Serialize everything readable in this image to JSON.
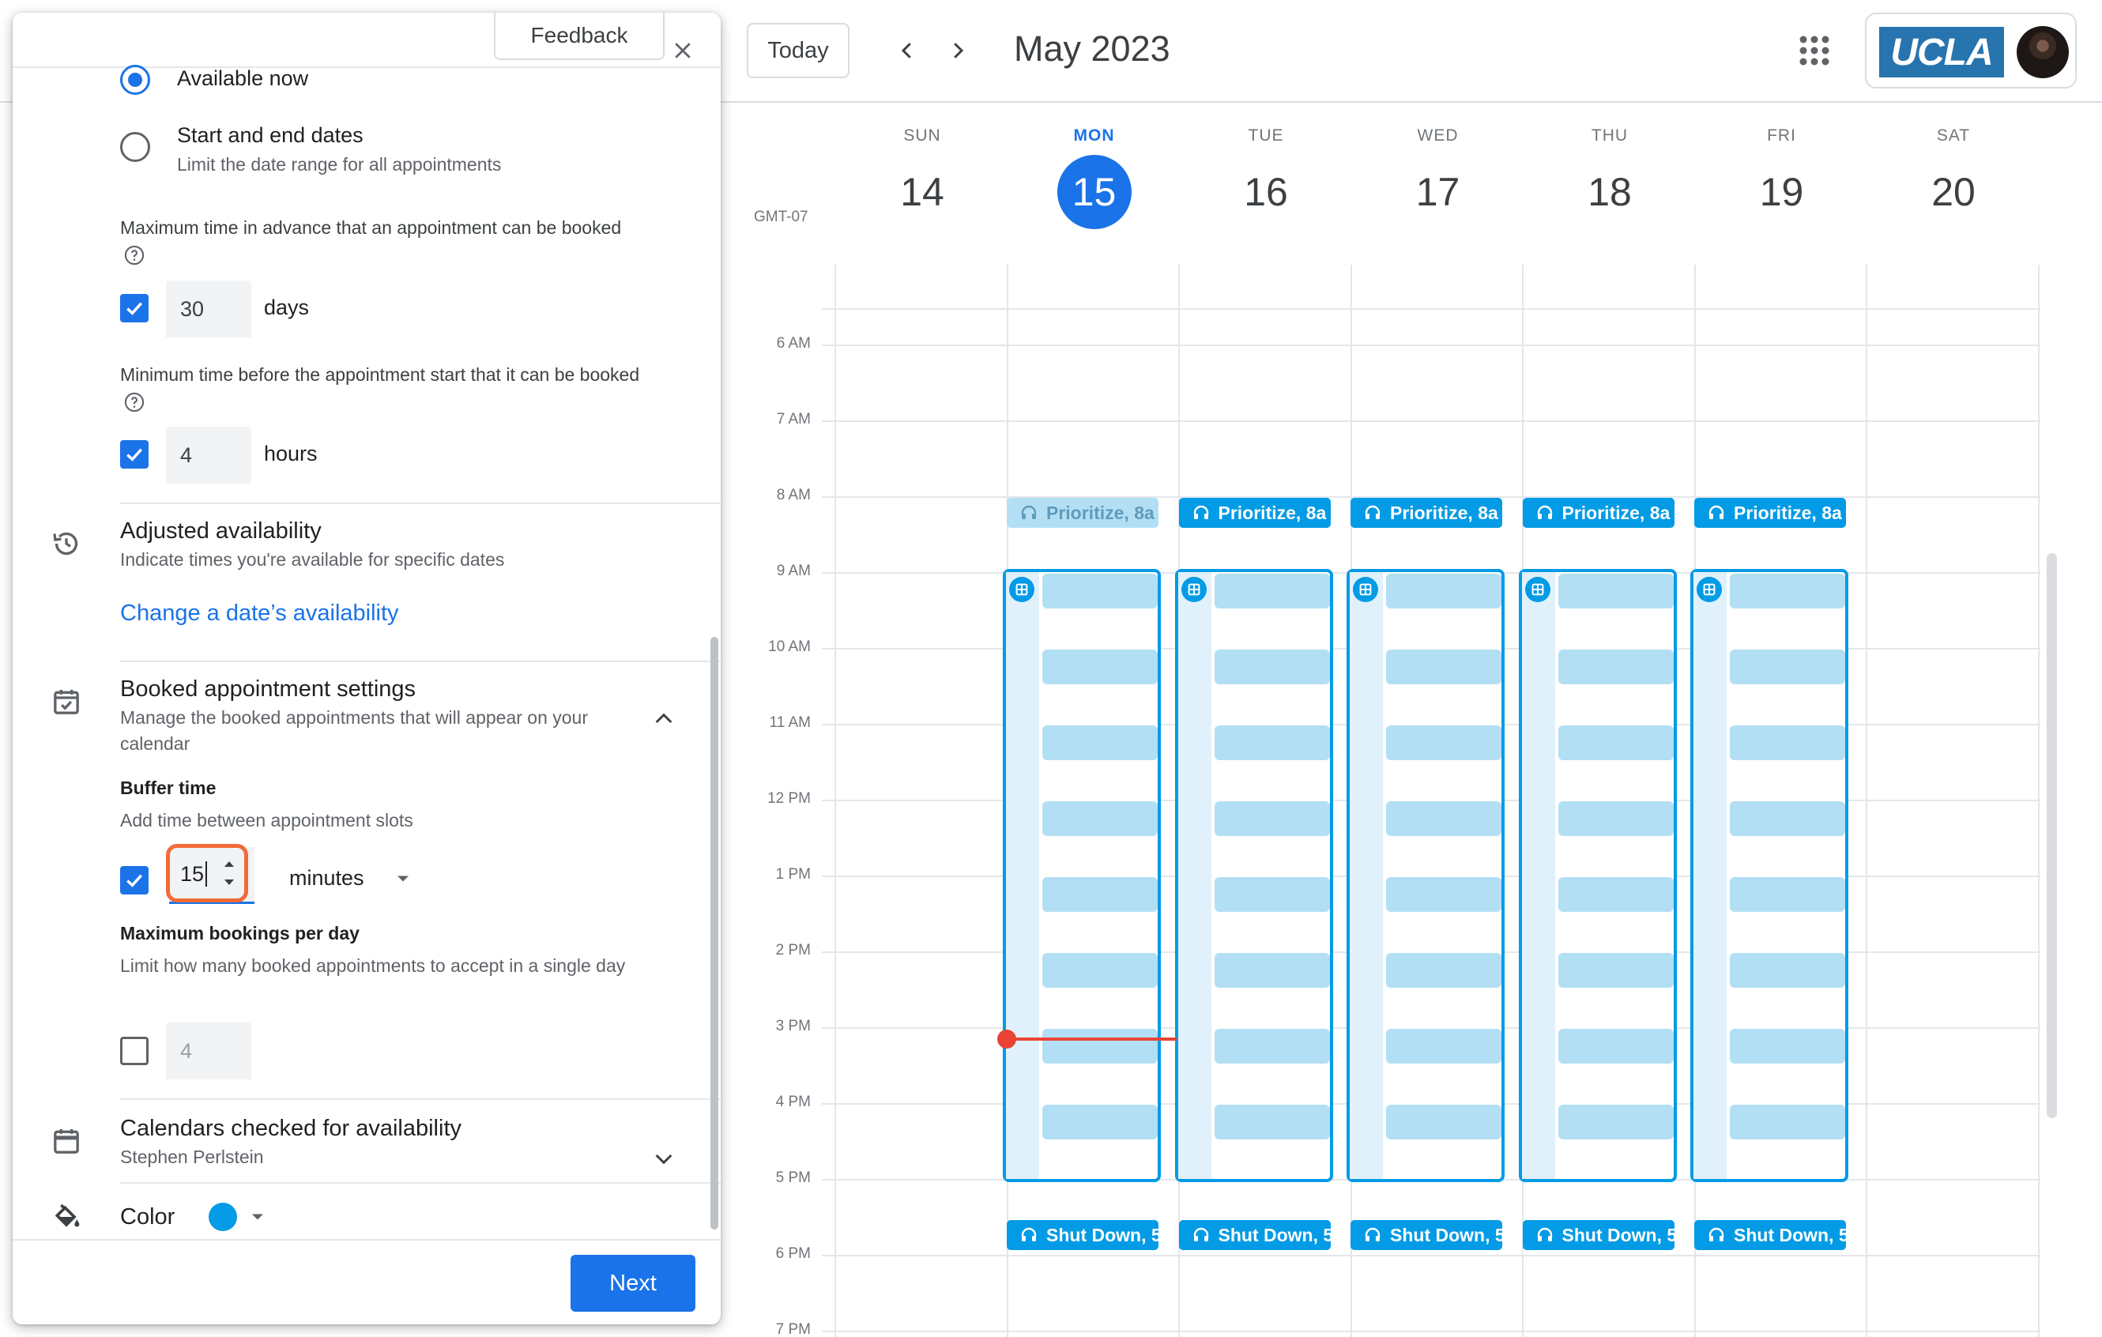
{
  "calendar": {
    "today_button": "Today",
    "month_title": "May 2023",
    "timezone": "GMT-07",
    "account_logo_text": "UCLA",
    "days": [
      {
        "name": "SUN",
        "num": "14"
      },
      {
        "name": "MON",
        "num": "15",
        "is_today": true
      },
      {
        "name": "TUE",
        "num": "16"
      },
      {
        "name": "WED",
        "num": "17"
      },
      {
        "name": "THU",
        "num": "18"
      },
      {
        "name": "FRI",
        "num": "19"
      },
      {
        "name": "SAT",
        "num": "20"
      }
    ],
    "hours": [
      "6 AM",
      "7 AM",
      "8 AM",
      "9 AM",
      "10 AM",
      "11 AM",
      "12 PM",
      "1 PM",
      "2 PM",
      "3 PM",
      "4 PM",
      "5 PM",
      "6 PM",
      "7 PM"
    ],
    "morning_event": "Prioritize, 8a",
    "evening_event": "Shut Down, 5",
    "event_color": "#039be5",
    "now_indicator_color": "#ea4335"
  },
  "panel": {
    "feedback_button": "Feedback",
    "available_now": "Available now",
    "start_end_dates": "Start and end dates",
    "start_end_dates_desc": "Limit the date range for all appointments",
    "max_advance_label": "Maximum time in advance that an appointment can be booked",
    "max_advance_value": "30",
    "max_advance_unit": "days",
    "min_before_label": "Minimum time before the appointment start that it can be booked",
    "min_before_value": "4",
    "min_before_unit": "hours",
    "adjusted_title": "Adjusted availability",
    "adjusted_desc": "Indicate times you're available for specific dates",
    "adjusted_link": "Change a date’s availability",
    "booked_title": "Booked appointment settings",
    "booked_desc": "Manage the booked appointments that will appear on your calendar",
    "buffer_title": "Buffer time",
    "buffer_desc": "Add time between appointment slots",
    "buffer_value": "15",
    "buffer_unit": "minutes",
    "max_bookings_title": "Maximum bookings per day",
    "max_bookings_desc": "Limit how many booked appointments to accept in a single day",
    "max_bookings_value": "4",
    "calendars_title": "Calendars checked for availability",
    "calendars_desc": "Stephen Perlstein",
    "color_label": "Color",
    "color_value": "#039be5",
    "next_button": "Next"
  }
}
